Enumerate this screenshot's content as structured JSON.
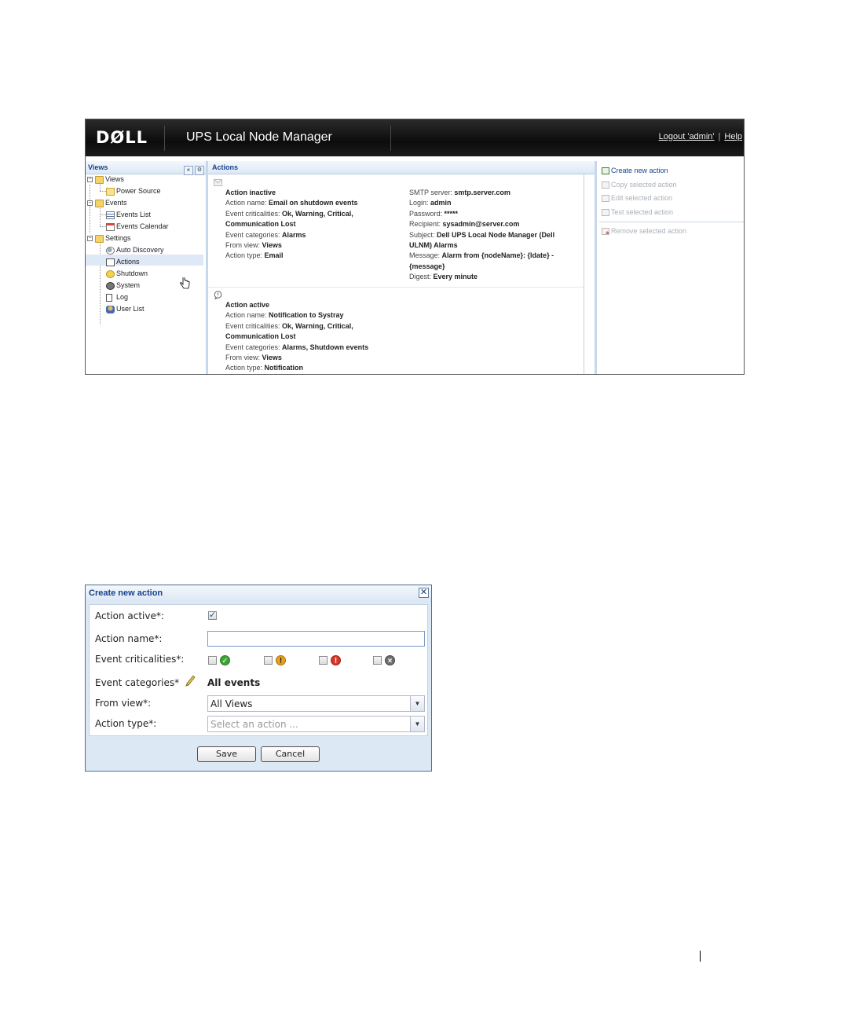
{
  "app": {
    "logo": "DØLL",
    "title": "UPS Local Node Manager",
    "logout": "Logout 'admin'",
    "help": "Help"
  },
  "left": {
    "header": "Views",
    "collapse_glyph": "«",
    "gear_glyph": "⚙",
    "tree": {
      "views": "Views",
      "power_source": "Power Source",
      "events": "Events",
      "events_list": "Events List",
      "events_calendar": "Events Calendar",
      "settings": "Settings",
      "auto_discovery": "Auto Discovery",
      "actions": "Actions",
      "shutdown": "Shutdown",
      "system": "System",
      "log": "Log",
      "user_list": "User List"
    }
  },
  "main": {
    "header": "Actions",
    "action1": {
      "title": "Action inactive",
      "name_lbl": "Action name: ",
      "name": "Email on shutdown events",
      "crit_lbl": "Event criticalities: ",
      "crit1": "Ok, Warning, Critical,",
      "crit2": "Communication Lost",
      "cat_lbl": "Event categories: ",
      "cat": "Alarms",
      "view_lbl": "From view: ",
      "view": "Views",
      "type_lbl": "Action type: ",
      "type": "Email",
      "smtp_lbl": "SMTP server: ",
      "smtp": "smtp.server.com",
      "login_lbl": "Login: ",
      "login": "admin",
      "pwd_lbl": "Password: ",
      "pwd": "*****",
      "rcpt_lbl": "Recipient: ",
      "rcpt": "sysadmin@server.com",
      "subj_lbl": "Subject: ",
      "subj1": "Dell UPS Local Node Manager (Dell",
      "subj2": "ULNM) Alarms",
      "msg_lbl": "Message: ",
      "msg1": "Alarm from {nodeName}: {ldate} -",
      "msg2": "{message}",
      "digest_lbl": "Digest: ",
      "digest": "Every minute"
    },
    "action2": {
      "title": "Action active",
      "name_lbl": "Action name: ",
      "name": "Notification to Systray",
      "crit_lbl": "Event criticalities: ",
      "crit1": "Ok, Warning, Critical,",
      "crit2": "Communication Lost",
      "cat_lbl": "Event categories: ",
      "cat": "Alarms, Shutdown events",
      "view_lbl": "From view: ",
      "view": "Views",
      "type_lbl": "Action type: ",
      "type": "Notification"
    }
  },
  "right": {
    "create": "Create new action",
    "copy": "Copy selected action",
    "edit": "Edit selected action",
    "test": "Test selected action",
    "remove": "Remove selected action"
  },
  "dialog": {
    "title": "Create new action",
    "close_glyph": "✕",
    "active_lbl": "Action active*:",
    "name_lbl": "Action name*:",
    "name_value": "",
    "crit_lbl": "Event criticalities*:",
    "cat_lbl": "Event categories*",
    "cat_value": "All events",
    "view_lbl": "From view*:",
    "view_value": "All Views",
    "type_lbl": "Action type*:",
    "type_placeholder": "Select an action ...",
    "save": "Save",
    "cancel": "Cancel",
    "crit_glyphs": {
      "ok": "✓",
      "warning": "!",
      "critical": "!",
      "comm_lost": "×"
    },
    "colors": {
      "ok": "#3aa335",
      "warning": "#e4a11b",
      "critical": "#d9352b",
      "comm_lost": "#6e6e6e"
    },
    "dropdown_glyph": "▼"
  }
}
